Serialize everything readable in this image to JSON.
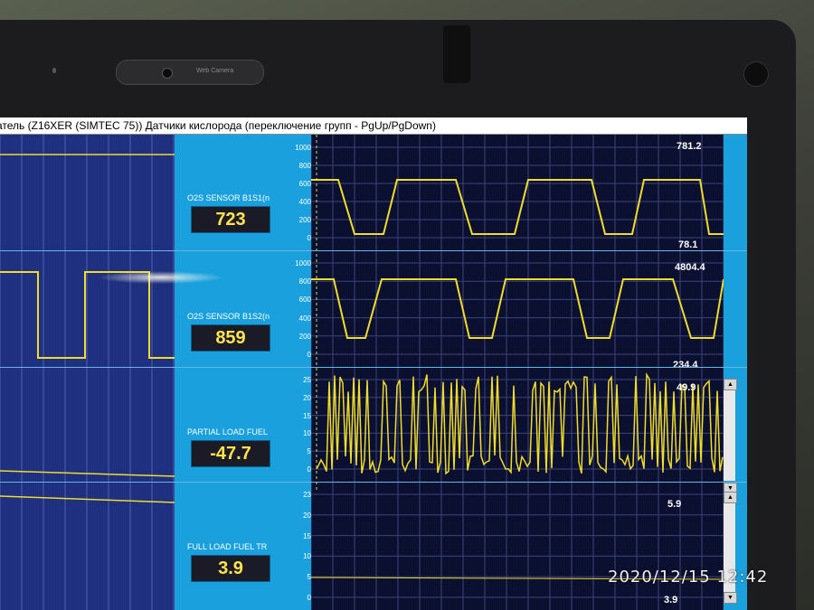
{
  "window": {
    "title": "атель (Z16XER (SIMTEC 75)) Датчики кислорода (переключение групп - PgUp/PgDown)"
  },
  "bezel": {
    "camera_label": "Web Camera"
  },
  "photo": {
    "timestamp": "2020/12/15  12:42"
  },
  "colors": {
    "trace": "#f0dc2a",
    "panel": "#1aa0dc",
    "plot_bg": "#0c1030",
    "left_bg": "#1f3080",
    "value_text": "#ffe54a"
  },
  "channels": [
    {
      "label": "O2S SENSOR B1S1(n",
      "value": "723",
      "scale_ticks": [
        "1000",
        "800",
        "600",
        "400",
        "200",
        "0"
      ],
      "max_label": "781.2",
      "min_label": "78.1"
    },
    {
      "label": "O2S SENSOR B1S2(n",
      "value": "859",
      "scale_ticks": [
        "1000",
        "800",
        "600",
        "400",
        "200",
        "0"
      ],
      "max_label": "4804.4",
      "min_label": "234.4"
    },
    {
      "label": "PARTIAL LOAD FUEL",
      "value": "-47.7",
      "scale_ticks": [
        "25",
        "20",
        "15",
        "10",
        "5",
        "0"
      ],
      "max_label": "49.9",
      "min_label": ""
    },
    {
      "label": "FULL LOAD FUEL TR",
      "value": "3.9",
      "scale_ticks": [
        "23",
        "20",
        "15",
        "10",
        "5",
        "0"
      ],
      "max_label": "5.9",
      "min_label": "3.9"
    }
  ]
}
